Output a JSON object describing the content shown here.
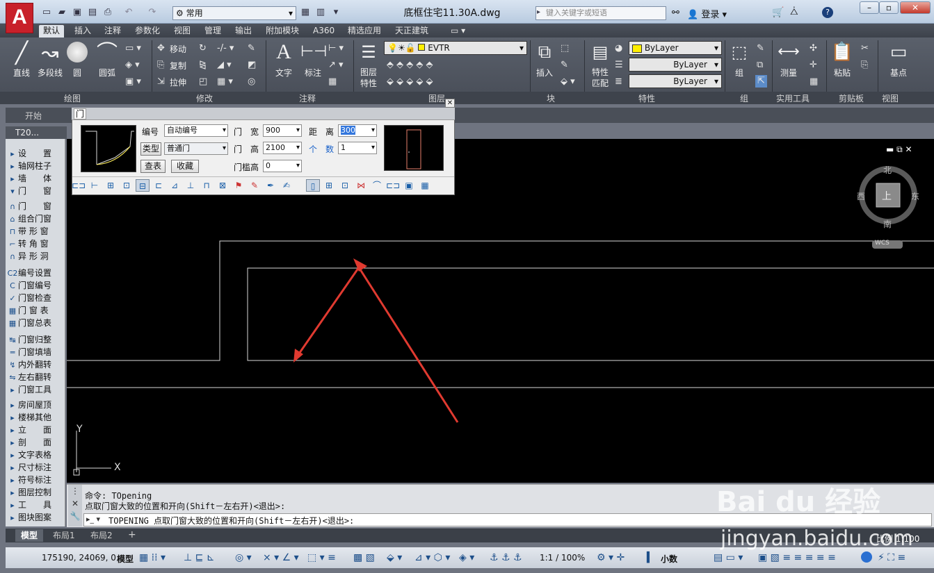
{
  "titlebar": {
    "workspace": "常用",
    "doc_title": "底框住宅11.30A.dwg",
    "search_placeholder": "键入关键字或短语",
    "login": "登录"
  },
  "ribbon_tabs": [
    "默认",
    "插入",
    "注释",
    "参数化",
    "视图",
    "管理",
    "输出",
    "附加模块",
    "A360",
    "精选应用",
    "天正建筑"
  ],
  "draw": {
    "line": "直线",
    "polyline": "多段线",
    "circle": "圆",
    "arc": "圆弧",
    "panel": "绘图"
  },
  "modify": {
    "move": "移动",
    "copy": "复制",
    "stretch": "拉伸",
    "panel": "修改"
  },
  "annotation": {
    "text": "文字",
    "dim": "标注",
    "panel": "注释"
  },
  "layers": {
    "props": "图层\n特性",
    "current": "EVTR",
    "panel": "图层"
  },
  "block": {
    "insert": "插入",
    "panel": "块"
  },
  "props": {
    "match": "特性\n匹配",
    "color": "ByLayer",
    "linetype": "ByLayer",
    "lineweight": "ByLayer",
    "panel": "特性"
  },
  "group": {
    "label": "组",
    "panel": "组"
  },
  "utilities": {
    "measure": "测量",
    "panel": "实用工具"
  },
  "clipboard": {
    "paste": "粘贴",
    "panel": "剪贴板"
  },
  "view": {
    "base": "基点",
    "panel": "视图"
  },
  "filetabs": {
    "start": "开始",
    "t20": "T20..."
  },
  "sidebar": [
    {
      "icon": "▸",
      "label": "设　　置"
    },
    {
      "icon": "▸",
      "label": "轴网柱子"
    },
    {
      "icon": "▸",
      "label": "墙　　体"
    },
    {
      "icon": "▾",
      "label": "门　　窗"
    },
    {
      "icon": "∩",
      "label": "门　　窗"
    },
    {
      "icon": "⌂",
      "label": "组合门窗"
    },
    {
      "icon": "⊓",
      "label": "带 形 窗"
    },
    {
      "icon": "⌐",
      "label": "转 角 窗"
    },
    {
      "icon": "∩",
      "label": "异 形 洞"
    },
    {
      "icon": "C2",
      "label": "编号设置"
    },
    {
      "icon": "C",
      "label": "门窗编号"
    },
    {
      "icon": "✓",
      "label": "门窗检查"
    },
    {
      "icon": "▦",
      "label": "门 窗 表"
    },
    {
      "icon": "▦",
      "label": "门窗总表"
    },
    {
      "icon": "↹",
      "label": "门窗归整"
    },
    {
      "icon": "═",
      "label": "门窗填墙"
    },
    {
      "icon": "↯",
      "label": "内外翻转"
    },
    {
      "icon": "⇋",
      "label": "左右翻转"
    },
    {
      "icon": "▸",
      "label": "门窗工具"
    },
    {
      "icon": "▸",
      "label": "房间屋顶"
    },
    {
      "icon": "▸",
      "label": "楼梯其他"
    },
    {
      "icon": "▸",
      "label": "立　　面"
    },
    {
      "icon": "▸",
      "label": "剖　　面"
    },
    {
      "icon": "▸",
      "label": "文字表格"
    },
    {
      "icon": "▸",
      "label": "尺寸标注"
    },
    {
      "icon": "▸",
      "label": "符号标注"
    },
    {
      "icon": "▸",
      "label": "图层控制"
    },
    {
      "icon": "▸",
      "label": "工　　具"
    },
    {
      "icon": "▸",
      "label": "图块图案"
    }
  ],
  "door_dialog": {
    "title": "门",
    "number_label": "编号",
    "number_value": "自动编号",
    "type_btn": "类型",
    "type_value": "普通门",
    "query_btn": "查表",
    "fav_btn": "收藏",
    "width_label": "门　宽",
    "width_value": "900",
    "height_label": "门　高",
    "height_value": "2100",
    "sill_label": "门槛高",
    "sill_value": "0",
    "dist_label": "距　离",
    "dist_value": "300",
    "count_label": "个　数",
    "count_value": "1"
  },
  "viewcube": {
    "north": "北",
    "south": "南",
    "east": "东",
    "west": "西",
    "top": "上",
    "wcs": "WCS"
  },
  "ucs": {
    "x": "X",
    "y": "Y"
  },
  "command": {
    "line1": "命令: TOpening",
    "line2": "点取门窗大致的位置和开向(Shift－左右开)<退出>:",
    "prompt": "TOPENING 点取门窗大致的位置和开向(Shift－左右开)<退出>:"
  },
  "layout_tabs": [
    "模型",
    "布局1",
    "布局2"
  ],
  "status": {
    "coords": "175190, 24069, 0",
    "model": "模型",
    "scale": "1:1 / 100%",
    "units": "小数",
    "ratio": "比例 1:100"
  },
  "watermark": {
    "brand": "Bai du 经验",
    "url": "jingyan.baidu.com"
  }
}
